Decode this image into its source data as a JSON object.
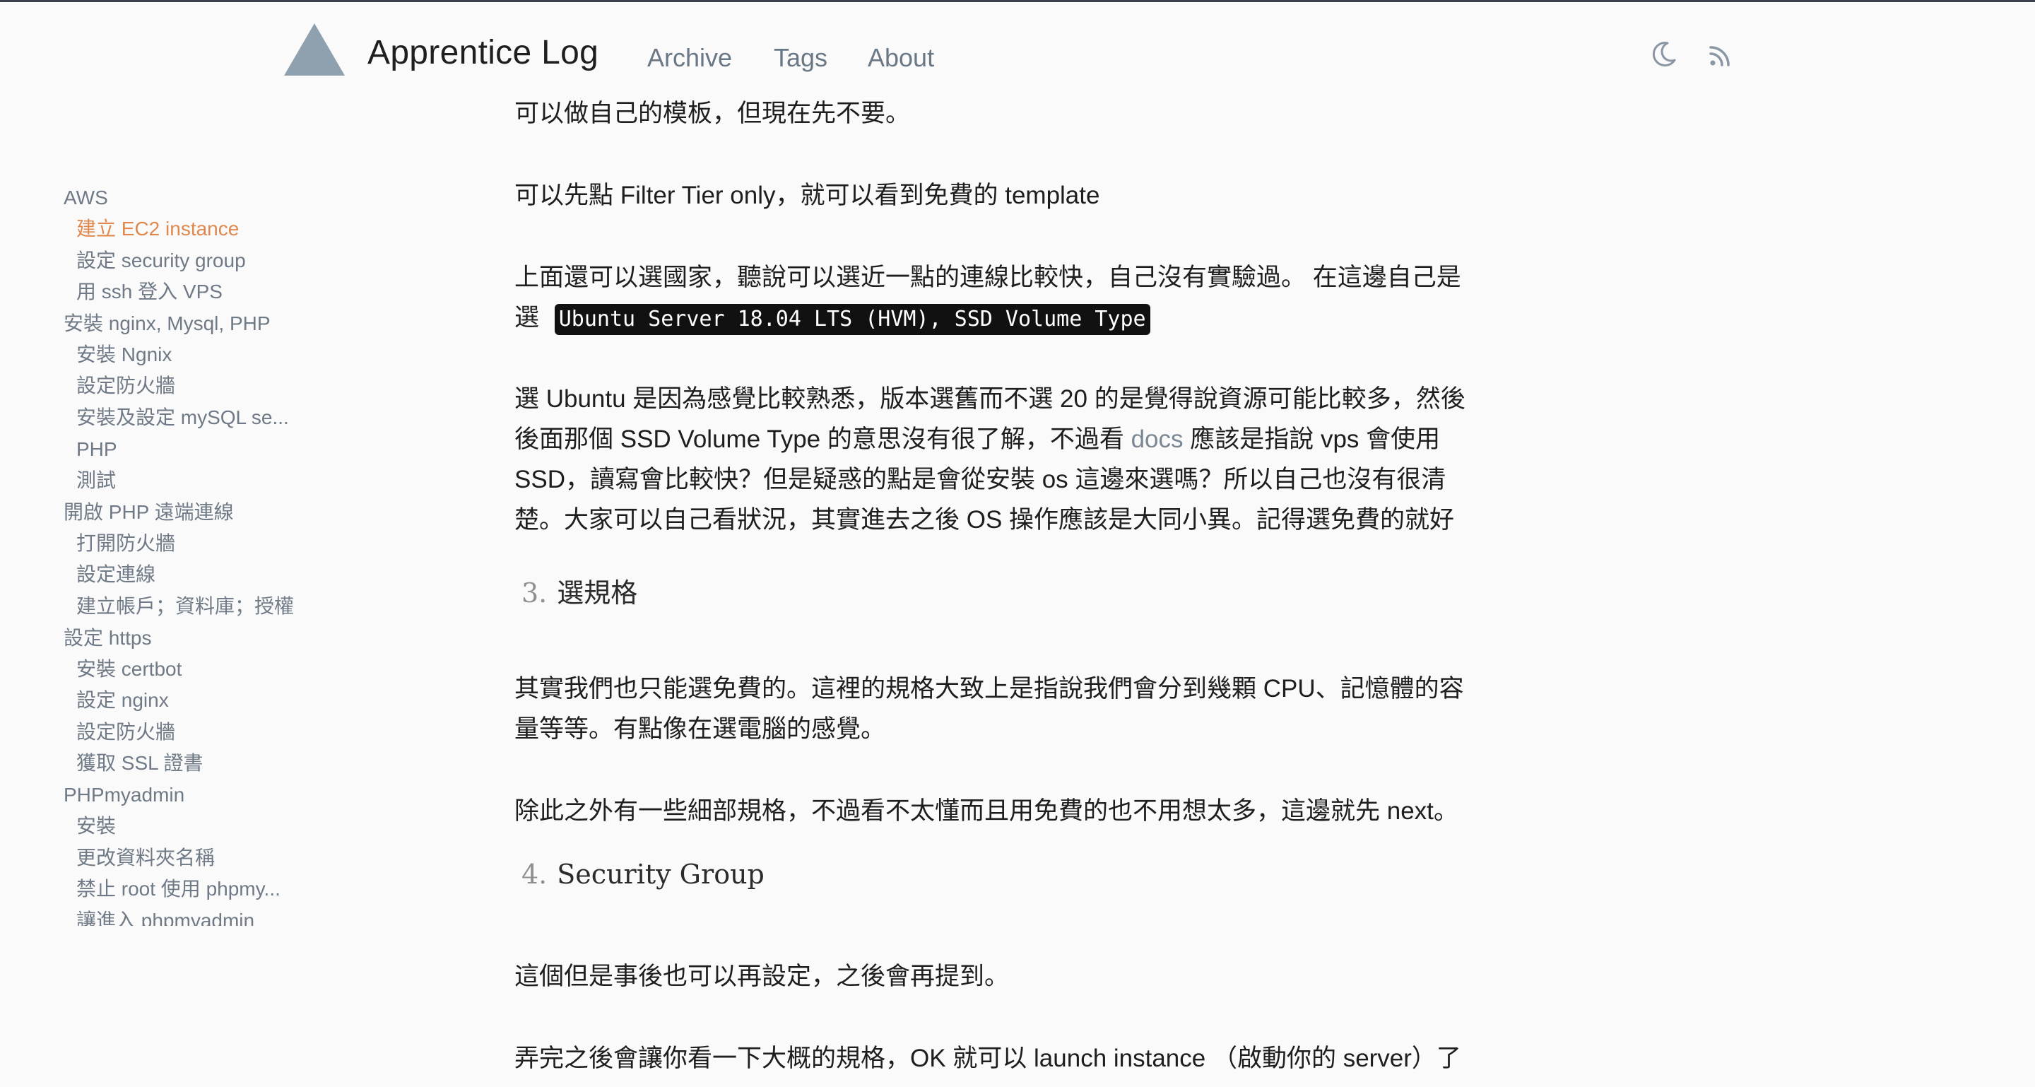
{
  "header": {
    "site_title": "Apprentice Log",
    "logo_icon": "triangle-logo",
    "nav": [
      "Archive",
      "Tags",
      "About"
    ],
    "icons": [
      "moon-icon",
      "rss-icon"
    ]
  },
  "toc": {
    "sections": [
      {
        "label": "AWS",
        "items": [
          "建立 EC2 instance",
          "設定 security group",
          "用 ssh 登入 VPS"
        ]
      },
      {
        "label": "安裝 nginx, Mysql, PHP",
        "items": [
          "安裝 Ngnix",
          "設定防火牆",
          "安裝及設定 mySQL se...",
          "PHP",
          "測試"
        ]
      },
      {
        "label": "開啟 PHP 遠端連線",
        "items": [
          "打開防火牆",
          "設定連線",
          "建立帳戶；資料庫；授權"
        ]
      },
      {
        "label": "設定 https",
        "items": [
          "安裝 certbot",
          "設定 nginx",
          "設定防火牆",
          "獲取 SSL 證書"
        ]
      },
      {
        "label": "PHPmyadmin",
        "items": [
          "安裝",
          "更改資料夾名稱",
          "禁止 root 使用 phpmy...",
          "讓進入 phpmyadmin"
        ]
      }
    ],
    "active_item": "建立 EC2 instance"
  },
  "article": {
    "p1": "可以做自己的模板，但現在先不要。",
    "p2": "可以先點 Filter Tier only，就可以看到免費的 template",
    "p3_line1": "上面還可以選國家，聽說可以選近一點的連線比較快，自己沒有實驗過。 在這邊自己是",
    "p3_line2_prefix": "選",
    "p3_code": "Ubuntu Server 18.04 LTS (HVM), SSD Volume Type",
    "p4_line1": "選 Ubuntu 是因為感覺比較熟悉，版本選舊而不選 20 的是覺得說資源可能比較多，然後",
    "p4_line2_a": "後面那個 SSD Volume Type 的意思沒有很了解，不過看 ",
    "p4_link": "docs",
    "p4_line2_b": " 應該是指說 vps 會使用",
    "p4_line3": "SSD，讀寫會比較快？但是疑惑的點是會從安裝 os 這邊來選嗎？所以自己也沒有很清",
    "p4_line4": "楚。大家可以自己看狀況，其實進去之後 OS 操作應該是大同小異。記得選免費的就好",
    "h3_num": "3.",
    "h3": "選規格",
    "p5_line1": "其實我們也只能選免費的。這裡的規格大致上是指說我們會分到幾顆 CPU、記憶體的容",
    "p5_line2": "量等等。有點像在選電腦的感覺。",
    "p6": "除此之外有一些細部規格，不過看不太懂而且用免費的也不用想太多，這邊就先 next。",
    "h4_num": "4.",
    "h4": "Security Group",
    "p7": "這個但是事後也可以再設定，之後會再提到。",
    "p8": "弄完之後會讓你看一下大概的規格，OK 就可以 launch instance （啟動你的 server）了"
  }
}
